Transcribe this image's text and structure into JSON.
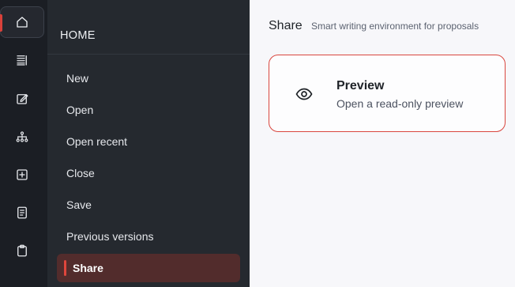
{
  "rail": {
    "icons": [
      "home-icon",
      "list-icon",
      "edit-icon",
      "tree-icon",
      "add-icon",
      "document-list-icon",
      "clipboard-icon"
    ],
    "active_index": 0
  },
  "menu": {
    "heading": "HOME",
    "items": [
      {
        "label": "New"
      },
      {
        "label": "Open"
      },
      {
        "label": "Open recent"
      },
      {
        "label": "Close"
      },
      {
        "label": "Save"
      },
      {
        "label": "Previous versions"
      },
      {
        "label": "Share"
      }
    ],
    "active_label": "Share"
  },
  "content": {
    "title": "Share",
    "subtitle": "Smart writing environment for proposals",
    "cards": [
      {
        "icon": "eye-icon",
        "title": "Preview",
        "description": "Open a read-only preview"
      }
    ]
  },
  "colors": {
    "accent": "#d9463e",
    "rail_bg": "#1b1e24",
    "menu_bg": "#25292f",
    "active_item_bg": "#522c2c",
    "content_bg": "#f7f7fa"
  }
}
